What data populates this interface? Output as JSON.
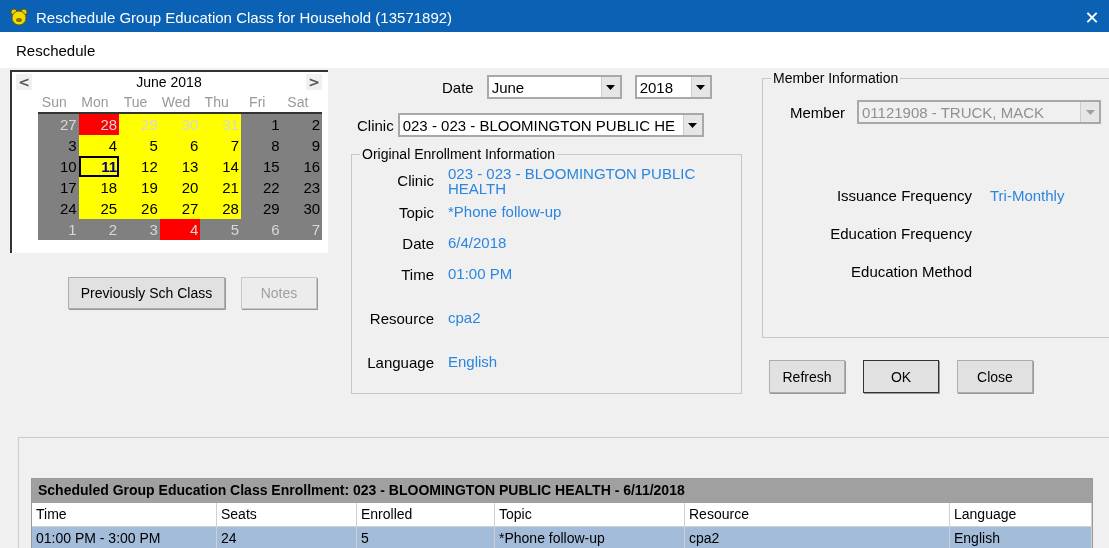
{
  "window": {
    "title": "Reschedule Group Education Class for Household (13571892)",
    "close": "✕"
  },
  "menu": [
    {
      "label": "Reschedule"
    }
  ],
  "calendar": {
    "prev": "<",
    "next": ">",
    "month": "June 2018",
    "weekdays": [
      "Sun",
      "Mon",
      "Tue",
      "Wed",
      "Thu",
      "Fri",
      "Sat"
    ],
    "days": [
      {
        "label": "27",
        "color": "#808080",
        "other_month": true,
        "selected": false
      },
      {
        "label": "28",
        "color": "#ff0000",
        "other_month": true,
        "selected": false
      },
      {
        "label": "29",
        "color": "#ffff00",
        "other_month": true,
        "selected": false
      },
      {
        "label": "30",
        "color": "#ffff00",
        "other_month": true,
        "selected": false
      },
      {
        "label": "31",
        "color": "#ffff00",
        "other_month": true,
        "selected": false
      },
      {
        "label": "1",
        "color": "#808080",
        "other_month": false,
        "selected": false
      },
      {
        "label": "2",
        "color": "#808080",
        "other_month": false,
        "selected": false
      },
      {
        "label": "3",
        "color": "#808080",
        "other_month": false,
        "selected": false
      },
      {
        "label": "4",
        "color": "#ffff00",
        "other_month": false,
        "selected": false
      },
      {
        "label": "5",
        "color": "#ffff00",
        "other_month": false,
        "selected": false
      },
      {
        "label": "6",
        "color": "#ffff00",
        "other_month": false,
        "selected": false
      },
      {
        "label": "7",
        "color": "#ffff00",
        "other_month": false,
        "selected": false
      },
      {
        "label": "8",
        "color": "#808080",
        "other_month": false,
        "selected": false
      },
      {
        "label": "9",
        "color": "#808080",
        "other_month": false,
        "selected": false
      },
      {
        "label": "10",
        "color": "#808080",
        "other_month": false,
        "selected": false
      },
      {
        "label": "11",
        "color": "#ffff00",
        "other_month": false,
        "selected": true
      },
      {
        "label": "12",
        "color": "#ffff00",
        "other_month": false,
        "selected": false
      },
      {
        "label": "13",
        "color": "#ffff00",
        "other_month": false,
        "selected": false
      },
      {
        "label": "14",
        "color": "#ffff00",
        "other_month": false,
        "selected": false
      },
      {
        "label": "15",
        "color": "#808080",
        "other_month": false,
        "selected": false
      },
      {
        "label": "16",
        "color": "#808080",
        "other_month": false,
        "selected": false
      },
      {
        "label": "17",
        "color": "#808080",
        "other_month": false,
        "selected": false
      },
      {
        "label": "18",
        "color": "#ffff00",
        "other_month": false,
        "selected": false
      },
      {
        "label": "19",
        "color": "#ffff00",
        "other_month": false,
        "selected": false
      },
      {
        "label": "20",
        "color": "#ffff00",
        "other_month": false,
        "selected": false
      },
      {
        "label": "21",
        "color": "#ffff00",
        "other_month": false,
        "selected": false
      },
      {
        "label": "22",
        "color": "#808080",
        "other_month": false,
        "selected": false
      },
      {
        "label": "23",
        "color": "#808080",
        "other_month": false,
        "selected": false
      },
      {
        "label": "24",
        "color": "#808080",
        "other_month": false,
        "selected": false
      },
      {
        "label": "25",
        "color": "#ffff00",
        "other_month": false,
        "selected": false
      },
      {
        "label": "26",
        "color": "#ffff00",
        "other_month": false,
        "selected": false
      },
      {
        "label": "27",
        "color": "#ffff00",
        "other_month": false,
        "selected": false
      },
      {
        "label": "28",
        "color": "#ffff00",
        "other_month": false,
        "selected": false
      },
      {
        "label": "29",
        "color": "#808080",
        "other_month": false,
        "selected": false
      },
      {
        "label": "30",
        "color": "#808080",
        "other_month": false,
        "selected": false
      },
      {
        "label": "1",
        "color": "#808080",
        "other_month": true,
        "selected": false
      },
      {
        "label": "2",
        "color": "#808080",
        "other_month": true,
        "selected": false
      },
      {
        "label": "3",
        "color": "#808080",
        "other_month": true,
        "selected": false
      },
      {
        "label": "4",
        "color": "#ff0000",
        "other_month": true,
        "selected": false
      },
      {
        "label": "5",
        "color": "#808080",
        "other_month": true,
        "selected": false
      },
      {
        "label": "6",
        "color": "#808080",
        "other_month": true,
        "selected": false
      },
      {
        "label": "7",
        "color": "#808080",
        "other_month": true,
        "selected": false
      }
    ]
  },
  "left_buttons": [
    {
      "label": "Previously Sch Class",
      "disabled": false
    },
    {
      "label": "Notes",
      "disabled": true
    }
  ],
  "date_selector": {
    "label": "Date",
    "month": "June",
    "year": "2018"
  },
  "clinic_selector": {
    "label": "Clinic",
    "value": "023 - 023 - BLOOMINGTON PUBLIC HE"
  },
  "original_enrollment": {
    "title": "Original Enrollment Information",
    "fields": [
      {
        "label": "Clinic",
        "value": "023 - 023 - BLOOMINGTON PUBLIC HEALTH"
      },
      {
        "label": "Topic",
        "value": "*Phone follow-up"
      },
      {
        "label": "Date",
        "value": "6/4/2018"
      },
      {
        "label": "Time",
        "value": "01:00 PM"
      },
      {
        "label": "Resource",
        "value": "cpa2"
      },
      {
        "label": "Language",
        "value": "English"
      }
    ]
  },
  "member_information": {
    "title": "Member Information",
    "member_label": "Member",
    "member_value": "01121908 - TRUCK, MACK",
    "member_disabled": true,
    "fields": [
      {
        "label": "Issuance Frequency",
        "value": "Tri-Monthly"
      },
      {
        "label": "Education Frequency"
      },
      {
        "label": "Education Method"
      }
    ]
  },
  "action_buttons": [
    "Refresh",
    "OK",
    "Close"
  ],
  "table": {
    "title": "Scheduled Group Education Class Enrollment: 023 - BLOOMINGTON PUBLIC HEALTH - 6/11/2018",
    "columns": [
      "Time",
      "Seats",
      "Enrolled",
      "Topic",
      "Resource",
      "Language"
    ],
    "rows": [
      {
        "cells": [
          "01:00 PM - 3:00 PM",
          "24",
          "5",
          "*Phone follow-up",
          "cpa2",
          "English"
        ],
        "selected": true
      }
    ]
  }
}
